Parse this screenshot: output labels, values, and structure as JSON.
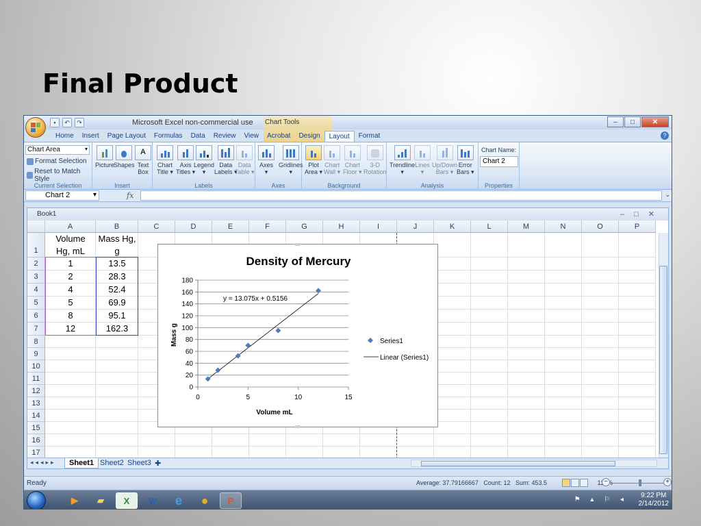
{
  "slide": {
    "title": "Final Product"
  },
  "window": {
    "title": "Microsoft Excel non-commercial use",
    "context_tab": "Chart Tools"
  },
  "ribbon_tabs": [
    "Home",
    "Insert",
    "Page Layout",
    "Formulas",
    "Data",
    "Review",
    "View",
    "Acrobat",
    "Design",
    "Layout",
    "Format"
  ],
  "ribbon": {
    "current_selection": {
      "dropdown": "Chart Area",
      "format_selection": "Format Selection",
      "reset_style": "Reset to Match Style",
      "group_label": "Current Selection"
    },
    "insert": {
      "picture": "Picture",
      "shapes": "Shapes",
      "textbox_1": "Text",
      "textbox_2": "Box",
      "group_label": "Insert"
    },
    "labels": {
      "chart_title_1": "Chart",
      "chart_title_2": "Title ▾",
      "axis_titles_1": "Axis",
      "axis_titles_2": "Titles ▾",
      "legend_1": "Legend",
      "legend_2": "▾",
      "data_labels_1": "Data",
      "data_labels_2": "Labels ▾",
      "data_table_1": "Data",
      "data_table_2": "Table ▾",
      "group_label": "Labels"
    },
    "axes": {
      "axes_1": "Axes",
      "axes_2": "▾",
      "gridlines_1": "Gridlines",
      "gridlines_2": "▾",
      "group_label": "Axes"
    },
    "background": {
      "plot_area_1": "Plot",
      "plot_area_2": "Area ▾",
      "chart_wall_1": "Chart",
      "chart_wall_2": "Wall ▾",
      "chart_floor_1": "Chart",
      "chart_floor_2": "Floor ▾",
      "rotation_1": "3-D",
      "rotation_2": "Rotation",
      "group_label": "Background"
    },
    "analysis": {
      "trendline_1": "Trendline",
      "trendline_2": "▾",
      "lines_1": "Lines",
      "lines_2": "▾",
      "updown_1": "Up/Down",
      "updown_2": "Bars ▾",
      "error_1": "Error",
      "error_2": "Bars ▾",
      "group_label": "Analysis"
    },
    "properties": {
      "chart_name_label": "Chart Name:",
      "chart_name_value": "Chart 2",
      "group_label": "Properties"
    }
  },
  "formula_bar": {
    "name_box": "Chart 2",
    "fx": "fx",
    "value": ""
  },
  "workbook": {
    "title": "Book1",
    "columns": [
      "A",
      "B",
      "C",
      "D",
      "E",
      "F",
      "G",
      "H",
      "I",
      "J",
      "K",
      "L",
      "M",
      "N",
      "O",
      "P"
    ],
    "rows": [
      "1",
      "2",
      "3",
      "4",
      "5",
      "6",
      "7",
      "8",
      "9",
      "10",
      "11",
      "12",
      "13",
      "14",
      "15",
      "16",
      "17"
    ],
    "header_a_line1": "Volume",
    "header_a_line2": "Hg, mL",
    "header_b_line1": "Mass Hg,",
    "header_b_line2": "g",
    "volume": [
      "1",
      "2",
      "4",
      "5",
      "8",
      "12"
    ],
    "mass": [
      "13.5",
      "28.3",
      "52.4",
      "69.9",
      "95.1",
      "162.3"
    ],
    "sheets": [
      "Sheet1",
      "Sheet2",
      "Sheet3"
    ]
  },
  "chart_data": {
    "type": "scatter",
    "title": "Density of Mercury",
    "xlabel": "Volume mL",
    "ylabel": "Mass g",
    "xlim": [
      0,
      15
    ],
    "ylim": [
      0,
      180
    ],
    "x_ticks": [
      "0",
      "5",
      "10",
      "15"
    ],
    "y_ticks": [
      "0",
      "20",
      "40",
      "60",
      "80",
      "100",
      "120",
      "140",
      "160",
      "180"
    ],
    "grid": "horizontal",
    "legend_position": "right",
    "series": [
      {
        "name": "Series1",
        "x": [
          1,
          2,
          4,
          5,
          8,
          12
        ],
        "y": [
          13.5,
          28.3,
          52.4,
          69.9,
          95.1,
          162.3
        ],
        "color": "#4a7ebb"
      }
    ],
    "trendline": {
      "name": "Linear (Series1)",
      "slope": 13.075,
      "intercept": 0.5156,
      "equation": "y = 13.075x + 0.5156"
    }
  },
  "status_bar": {
    "mode": "Ready",
    "average": "Average: 37.79166667",
    "count": "Count: 12",
    "sum": "Sum: 453.5",
    "zoom": "115%"
  },
  "taskbar": {
    "time": "9:22 PM",
    "date": "2/14/2012"
  }
}
